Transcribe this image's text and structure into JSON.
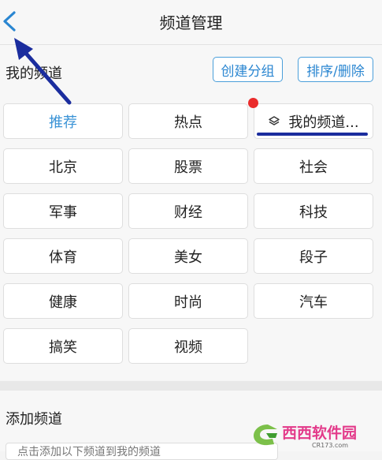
{
  "header": {
    "title": "频道管理"
  },
  "my_channels": {
    "title": "我的频道",
    "create_group_label": "创建分组",
    "sort_delete_label": "排序/删除",
    "tiles": [
      {
        "label": "推荐"
      },
      {
        "label": "热点"
      },
      {
        "label": "我的频道..."
      },
      {
        "label": "北京"
      },
      {
        "label": "股票"
      },
      {
        "label": "社会"
      },
      {
        "label": "军事"
      },
      {
        "label": "财经"
      },
      {
        "label": "科技"
      },
      {
        "label": "体育"
      },
      {
        "label": "美女"
      },
      {
        "label": "段子"
      },
      {
        "label": "健康"
      },
      {
        "label": "时尚"
      },
      {
        "label": "汽车"
      },
      {
        "label": "搞笑"
      },
      {
        "label": "视频"
      }
    ]
  },
  "add_channels": {
    "title": "添加频道",
    "hint_text": "点击添加以下频道到我的频道"
  },
  "watermark": {
    "brand": "西西软件园",
    "domain": "CR173.com"
  },
  "colors": {
    "accent": "#2a86d1",
    "badge": "#ea2c2c",
    "annotation": "#1b2d9e"
  },
  "icons": {
    "back": "chevron-left-icon",
    "layers": "layers-icon"
  }
}
